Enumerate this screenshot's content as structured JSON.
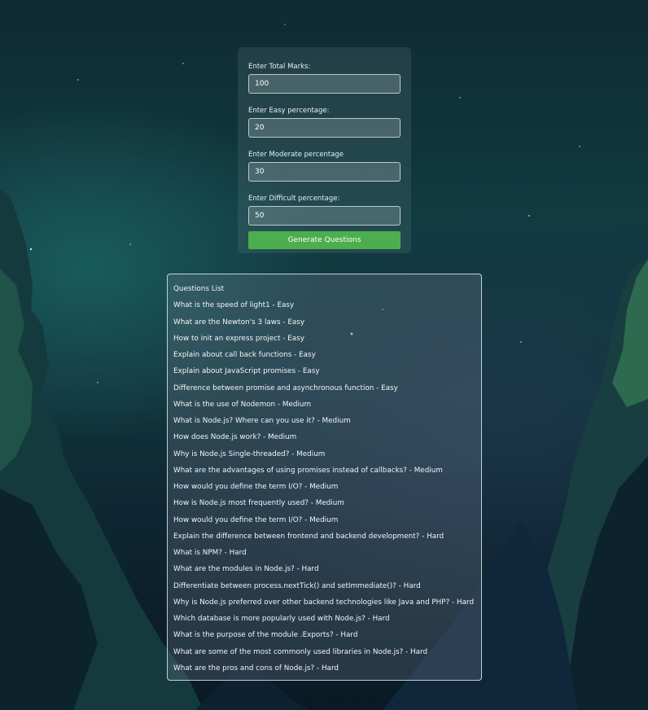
{
  "form": {
    "total_marks_label": "Enter Total Marks:",
    "total_marks_value": "100",
    "easy_label": "Enter Easy percentage:",
    "easy_value": "20",
    "moderate_label": "Enter Moderate percentage",
    "moderate_value": "30",
    "difficult_label": "Enter Difficult percentage:",
    "difficult_value": "50",
    "generate_button_label": "Generate Questions",
    "button_color": "#4cae4c"
  },
  "questions": {
    "title": "Questions List",
    "items": [
      "What is the speed of light1 - Easy",
      "What are the Newton's 3 laws - Easy",
      "How to init an express project - Easy",
      "Explain about call back functions - Easy",
      "Explain about JavaScript promises - Easy",
      "Difference between promise and asynchronous function - Easy",
      "What is the use of Nodemon - Medium",
      "What is Node.js? Where can you use it? - Medium",
      "How does Node.js work? - Medium",
      "Why is Node.js Single-threaded? - Medium",
      "What are the advantages of using promises instead of callbacks? - Medium",
      "How would you define the term I/O? - Medium",
      "How is Node.js most frequently used? - Medium",
      "How would you define the term I/O? - Medium",
      "Explain the difference between frontend and backend development? - Hard",
      "What is NPM? - Hard",
      "What are the modules in Node.js? - Hard",
      "Differentiate between process.nextTick() and setImmediate()? - Hard",
      "Why is Node.js preferred over other backend technologies like Java and PHP? - Hard",
      "Which database is more popularly used with Node.js? - Hard",
      "What is the purpose of the module .Exports? - Hard",
      "What are some of the most commonly used libraries in Node.js? - Hard",
      "What are the pros and cons of Node.js? - Hard"
    ]
  }
}
